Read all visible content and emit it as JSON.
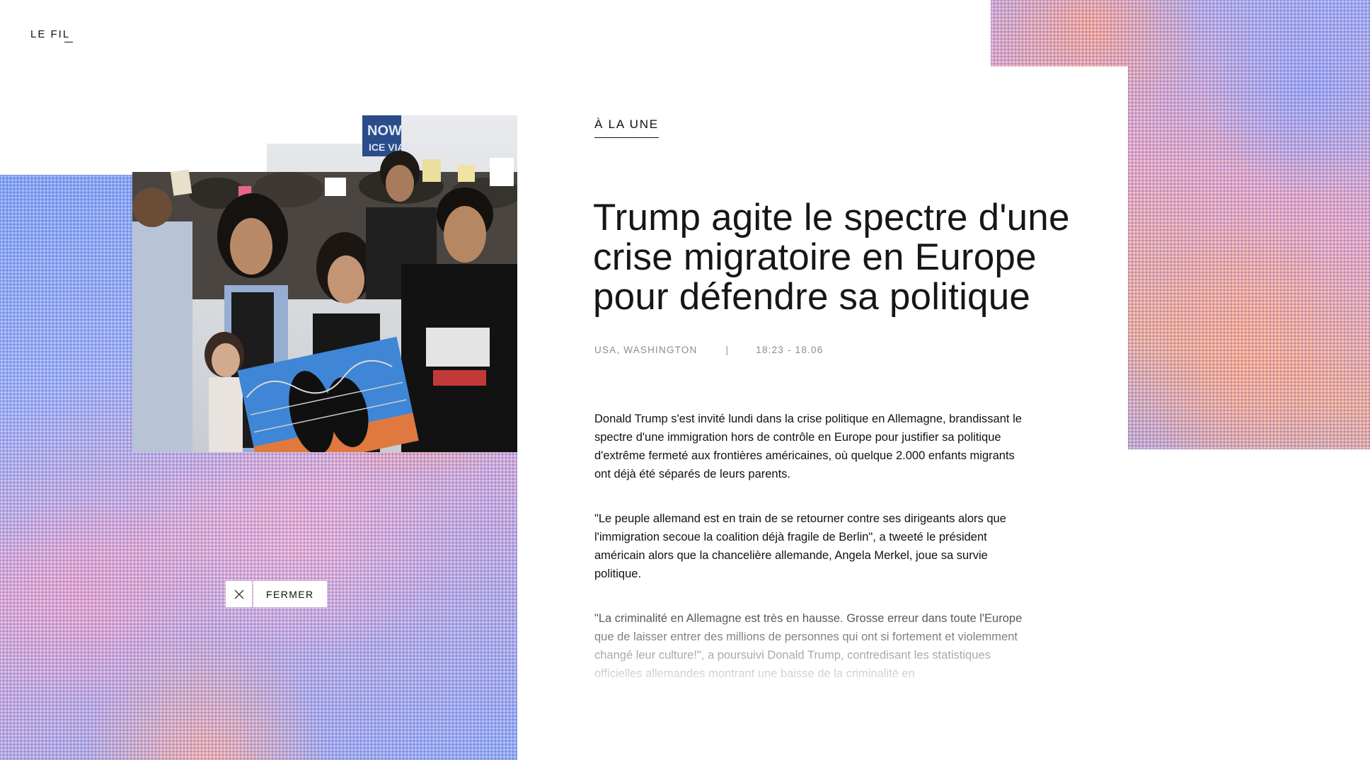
{
  "brand": {
    "logo_text_a": "LE FI",
    "logo_text_b": "L"
  },
  "close": {
    "label": "FERMER",
    "icon": "close-icon"
  },
  "article": {
    "section": "À LA UNE",
    "headline": "Trump agite le spectre d'une crise migratoire en Europe pour défendre sa politique",
    "location": "USA, WASHINGTON",
    "separator": "|",
    "time": "18:23 - 18.06",
    "paragraphs": [
      "Donald Trump s'est invité lundi dans la crise politique en Allemagne, brandissant le spectre d'une immigration hors de contrôle en Europe pour justifier sa politique d'extrême fermeté aux frontières américaines, où quelque 2.000 enfants migrants ont déjà été séparés de leurs parents.",
      "\"Le peuple allemand est en train de se retourner contre ses dirigeants alors que l'immigration secoue la coalition déjà fragile de Berlin\", a tweeté le président américain alors que la chancelière allemande, Angela Merkel, joue sa survie politique.",
      "\"La criminalité en Allemagne est très en hausse. Grosse erreur dans toute l'Europe que de laisser entrer des millions de personnes qui ont si fortement et violemment changé leur culture!\", a poursuivi Donald Trump, contredisant les statistiques officielles allemandes montrant une baisse de la criminalité en"
    ]
  },
  "photo": {
    "sign_text": "NOW ICE VIA!",
    "colors": {
      "sky": "#d9dde2",
      "crowd": "#3a3631",
      "shirt_black": "#141414",
      "poster_blue": "#3f86d6",
      "poster_orange": "#e0793f"
    }
  },
  "colors": {
    "accent_blue": "#7f9ef0",
    "accent_orange": "#f0a890",
    "accent_pink": "#e5a3bf",
    "text": "#111111",
    "meta": "#8c8c8c"
  }
}
